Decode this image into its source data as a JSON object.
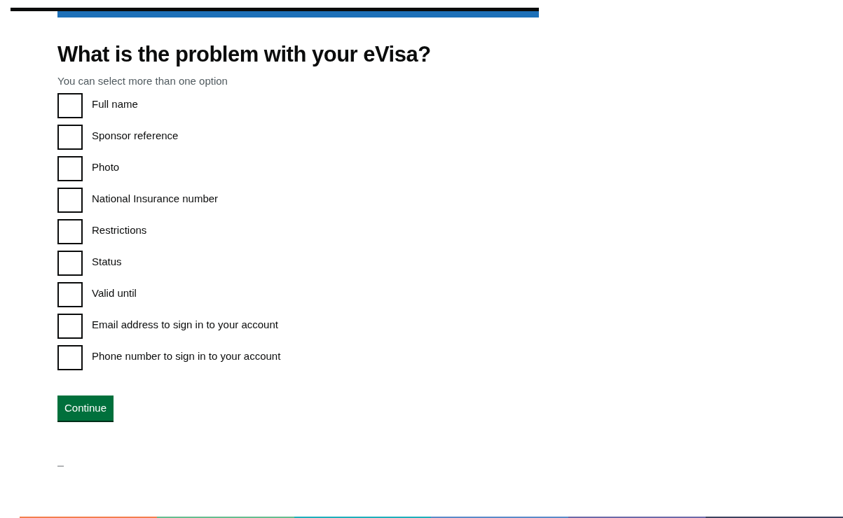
{
  "heading": "What is the problem with your eVisa?",
  "hint": "You can select more than one option",
  "options": [
    {
      "label": "Full name",
      "checked": false
    },
    {
      "label": "Sponsor reference",
      "checked": false
    },
    {
      "label": "Photo",
      "checked": false
    },
    {
      "label": "National Insurance number",
      "checked": false
    },
    {
      "label": "Restrictions",
      "checked": false
    },
    {
      "label": "Status",
      "checked": false
    },
    {
      "label": "Valid until",
      "checked": false
    },
    {
      "label": "Email address to sign in to your account",
      "checked": false
    },
    {
      "label": "Phone number to sign in to your account",
      "checked": false
    }
  ],
  "button": "Continue"
}
